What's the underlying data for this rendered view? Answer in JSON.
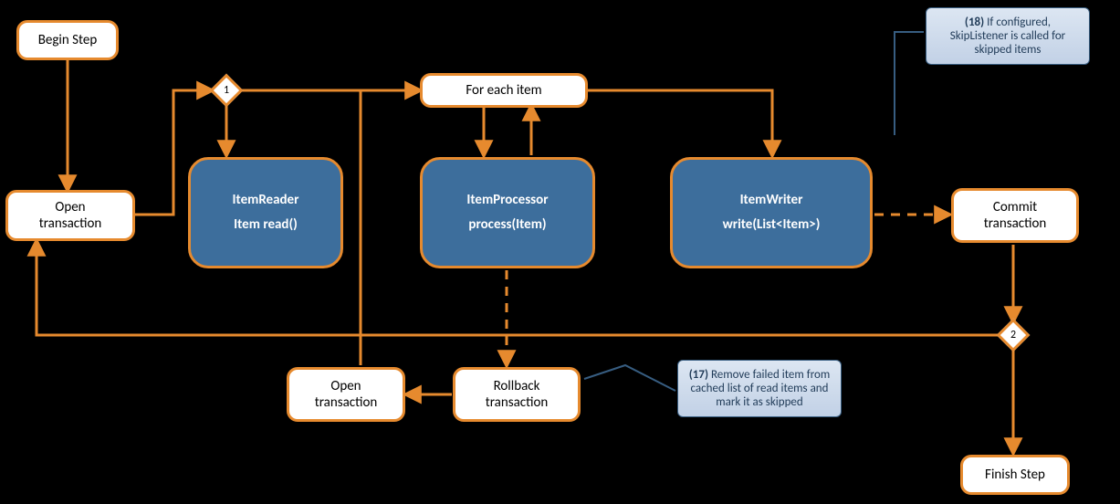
{
  "nodes": {
    "begin_step": "Begin Step",
    "open_transaction": "Open\ntransaction",
    "for_each_item": "For each item",
    "item_reader_title": "ItemReader",
    "item_reader_method": "Item read()",
    "item_processor_title": "ItemProcessor",
    "item_processor_method": "process(Item)",
    "item_writer_title": "ItemWriter",
    "item_writer_method": "write(List<Item>)",
    "commit_transaction": "Commit\ntransaction",
    "open_transaction2": "Open\ntransaction",
    "rollback_transaction": "Rollback\ntransaction",
    "finish_step": "Finish Step",
    "decision1": "1",
    "decision2": "2"
  },
  "notes": {
    "note17_num": "(17)",
    "note17_text": " Remove failed item from cached list of read items and mark it as skipped",
    "note18_num": "(18)",
    "note18_text": " If configured, SkipListener is called for skipped items"
  },
  "chart_data": {
    "type": "flowchart",
    "nodes": [
      {
        "id": "begin_step",
        "label": "Begin Step",
        "shape": "rect"
      },
      {
        "id": "open_txn",
        "label": "Open transaction",
        "shape": "rect"
      },
      {
        "id": "d1",
        "label": "1",
        "shape": "diamond"
      },
      {
        "id": "for_each",
        "label": "For each item",
        "shape": "rect"
      },
      {
        "id": "reader",
        "label": "ItemReader / Item read()",
        "shape": "rounded-blue"
      },
      {
        "id": "processor",
        "label": "ItemProcessor / process(Item)",
        "shape": "rounded-blue"
      },
      {
        "id": "writer",
        "label": "ItemWriter / write(List<Item>)",
        "shape": "rounded-blue"
      },
      {
        "id": "commit_txn",
        "label": "Commit transaction",
        "shape": "rect"
      },
      {
        "id": "d2",
        "label": "2",
        "shape": "diamond"
      },
      {
        "id": "finish_step",
        "label": "Finish Step",
        "shape": "rect"
      },
      {
        "id": "rollback_txn",
        "label": "Rollback transaction",
        "shape": "rect"
      },
      {
        "id": "open_txn2",
        "label": "Open transaction",
        "shape": "rect"
      },
      {
        "id": "note17",
        "label": "(17) Remove failed item from cached list of read items and mark it as skipped",
        "shape": "note"
      },
      {
        "id": "note18",
        "label": "(18) If configured, SkipListener is called for skipped items",
        "shape": "note"
      }
    ],
    "edges": [
      {
        "from": "begin_step",
        "to": "open_txn",
        "style": "solid"
      },
      {
        "from": "open_txn",
        "to": "d1",
        "style": "solid"
      },
      {
        "from": "d1",
        "to": "reader",
        "style": "solid"
      },
      {
        "from": "d1",
        "to": "for_each",
        "style": "solid"
      },
      {
        "from": "for_each",
        "to": "processor",
        "style": "solid-bidir"
      },
      {
        "from": "for_each",
        "to": "writer",
        "style": "solid"
      },
      {
        "from": "writer",
        "to": "commit_txn",
        "style": "dashed"
      },
      {
        "from": "commit_txn",
        "to": "d2",
        "style": "solid"
      },
      {
        "from": "d2",
        "to": "finish_step",
        "style": "solid"
      },
      {
        "from": "d2",
        "to": "open_txn",
        "style": "solid-loop"
      },
      {
        "from": "processor",
        "to": "rollback_txn",
        "style": "dashed"
      },
      {
        "from": "rollback_txn",
        "to": "open_txn2",
        "style": "solid"
      },
      {
        "from": "open_txn2",
        "to": "for_each",
        "style": "solid-loop-up"
      },
      {
        "from": "writer",
        "to": "note18",
        "style": "bracket"
      },
      {
        "from": "rollback_txn",
        "to": "note17",
        "style": "bracket"
      }
    ]
  }
}
